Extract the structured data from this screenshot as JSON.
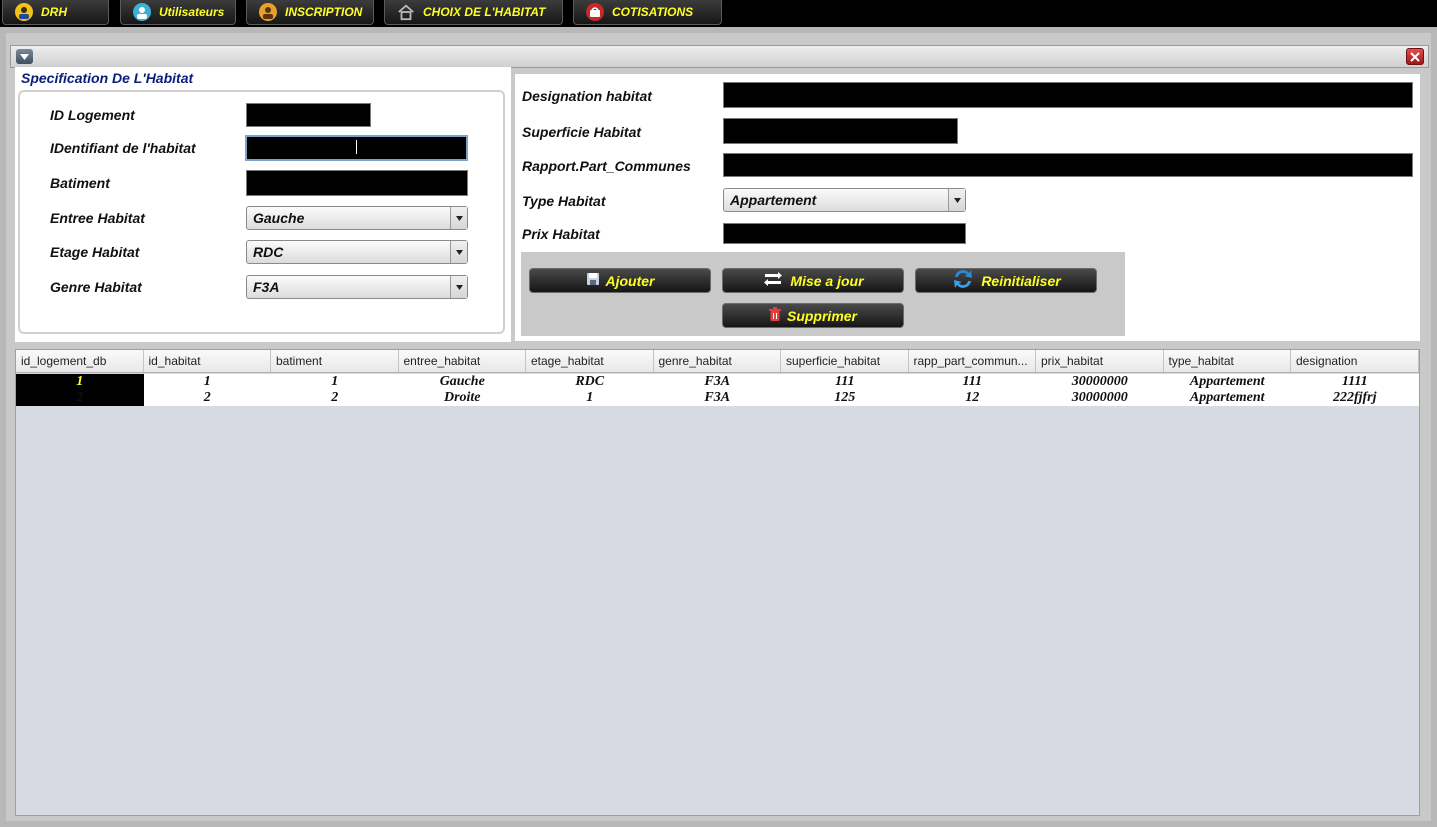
{
  "nav": {
    "drh": "DRH",
    "utilisateurs": "Utilisateurs",
    "inscription": "INSCRIPTION",
    "choix_habitat": "CHOIX DE L'HABITAT",
    "cotisations": "COTISATIONS"
  },
  "spec": {
    "title": "Specification De L'Habitat",
    "id_logement_label": "ID Logement",
    "identifiant_label": "IDentifiant de l'habitat",
    "batiment_label": "Batiment",
    "entree_label": "Entree Habitat",
    "entree_value": "Gauche",
    "etage_label": "Etage Habitat",
    "etage_value": "RDC",
    "genre_label": "Genre Habitat",
    "genre_value": "F3A"
  },
  "details": {
    "designation_label": "Designation habitat",
    "superficie_label": "Superficie Habitat",
    "rapport_label": "Rapport.Part_Communes",
    "type_label": "Type Habitat",
    "type_value": "Appartement",
    "prix_label": "Prix Habitat"
  },
  "actions": {
    "ajouter": "Ajouter",
    "mise_a_jour": "Mise a jour",
    "reinitialiser": "Reinitialiser",
    "supprimer": "Supprimer"
  },
  "table": {
    "columns": [
      "id_logement_db",
      "id_habitat",
      "batiment",
      "entree_habitat",
      "etage_habitat",
      "genre_habitat",
      "superficie_habitat",
      "rapp_part_commun...",
      "prix_habitat",
      "type_habitat",
      "designation"
    ],
    "rows": [
      [
        "1",
        "1",
        "1",
        "Gauche",
        "RDC",
        "F3A",
        "111",
        "111",
        "30000000",
        "Appartement",
        "1111"
      ],
      [
        "2",
        "2",
        "2",
        "Droite",
        "1",
        "F3A",
        "125",
        "12",
        "30000000",
        "Appartement",
        "222fjfrj"
      ]
    ]
  },
  "colors": {
    "accent_text": "#ffff24",
    "title_blue": "#0a1e7a",
    "button_dark": "#1e1e1e",
    "table_bg": "#d7dae2"
  },
  "icons": [
    "user-drh-icon",
    "user-icon",
    "inscription-user-icon",
    "house-icon",
    "cotisations-basket-icon",
    "save-icon",
    "refresh-icon",
    "reset-icon",
    "trash-icon",
    "close-icon",
    "menu-arrow-icon",
    "dropdown-arrow-icon"
  ]
}
